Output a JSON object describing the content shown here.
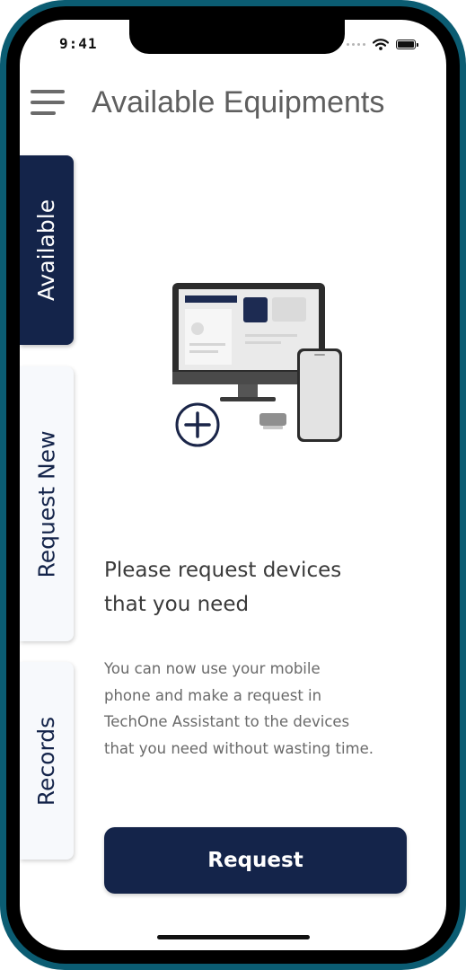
{
  "status_bar": {
    "time": "9:41"
  },
  "header": {
    "title": "Available Equipments"
  },
  "tabs": [
    {
      "label": "Available",
      "active": true
    },
    {
      "label": "Request New",
      "active": false
    },
    {
      "label": "Records",
      "active": false
    }
  ],
  "illustration": {
    "icon": "devices-illustration"
  },
  "content": {
    "heading_lines": [
      "Please request devices",
      "that you need"
    ],
    "description_lines": [
      "You can now use your mobile",
      "phone and make a request in",
      "TechOne Assistant to the devices",
      "that you need without wasting time."
    ]
  },
  "actions": {
    "request_label": "Request"
  },
  "colors": {
    "primary": "#14244a",
    "frame": "#0b5c72",
    "tab_inactive": "#f7f9fc"
  }
}
